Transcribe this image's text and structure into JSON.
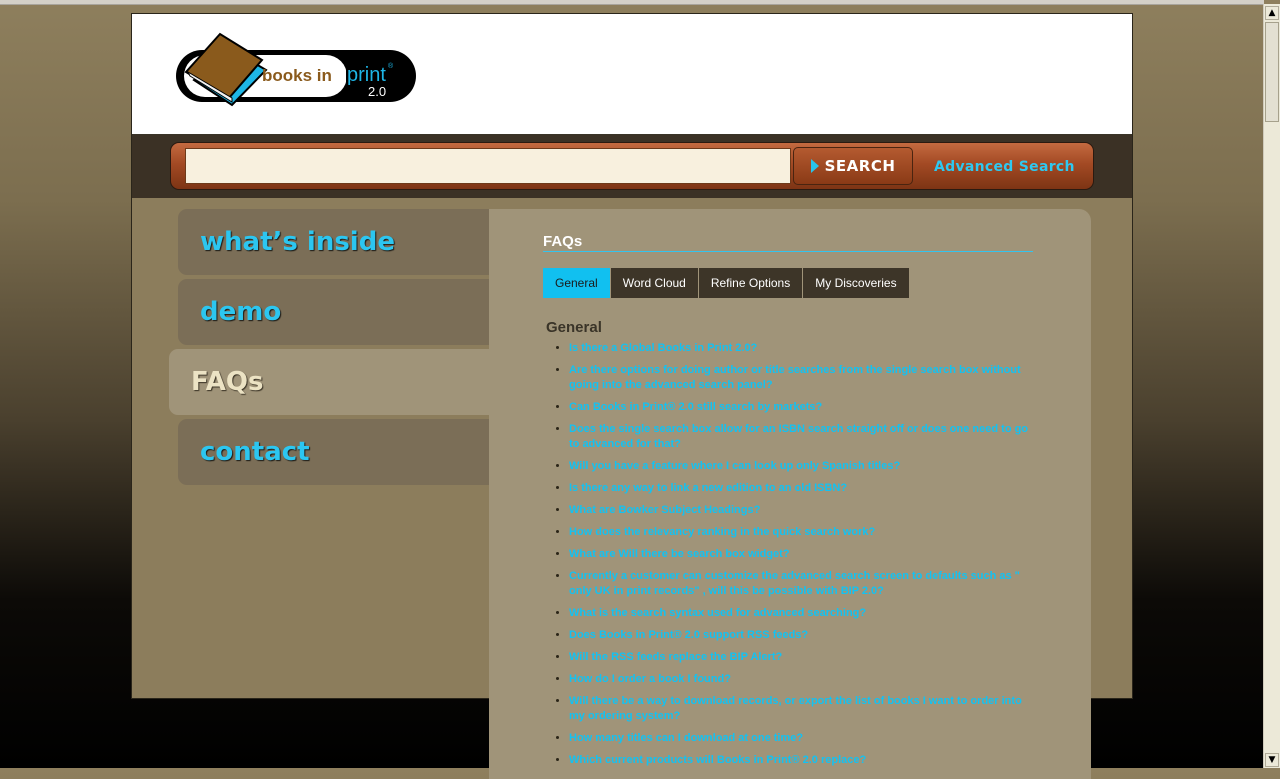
{
  "logo": {
    "text_books": "books in",
    "text_print": "print",
    "registered": "®",
    "version": "2.0"
  },
  "search": {
    "placeholder": "",
    "button_label": "SEARCH",
    "advanced_label": "Advanced Search"
  },
  "nav": {
    "items": [
      {
        "label": "what’s inside"
      },
      {
        "label": "demo"
      },
      {
        "label": "FAQs"
      },
      {
        "label": "contact"
      }
    ]
  },
  "faq": {
    "title": "FAQs",
    "tabs": [
      {
        "label": "General"
      },
      {
        "label": "Word Cloud"
      },
      {
        "label": "Refine Options"
      },
      {
        "label": "My Discoveries"
      }
    ],
    "section_title": "General",
    "questions": [
      "Is there a Global Books in Print 2.0?",
      "Are there options for doing author or title searches from the single search box without going into the advanced search panel?",
      "Can Books in Print® 2.0 still search by markets?",
      "Does the single search box allow for an ISBN search straight off or does one need to go to advanced for that?",
      "Will you have a feature where I can look up only Spanish titles?",
      "Is there any way to link a new edition to an old ISBN?",
      "What are Bowker Subject Headings?",
      "How does the relevancy ranking in the quick search work?",
      "What are Will there be search box widget?",
      "Currently a customer can customize the advanced search screen to defaults such as \" only UK in print records\" , will this be possible with BIP 2.0?",
      "What is the search syntax used for advanced searching?",
      "Does Books in Print® 2.0 support RSS feeds?",
      "Will the RSS feeds replace the BIP Alert?",
      "How do I order a book I found?",
      "Will there be a way to download records, or export the list of books I want to order into my ordering system?",
      "How many titles can I download at one time?",
      "Which current products will Books in Print® 2.0 replace?"
    ]
  },
  "colors": {
    "accent": "#13c2f2",
    "panel": "#a09479",
    "search_bar": "#a34a24"
  }
}
